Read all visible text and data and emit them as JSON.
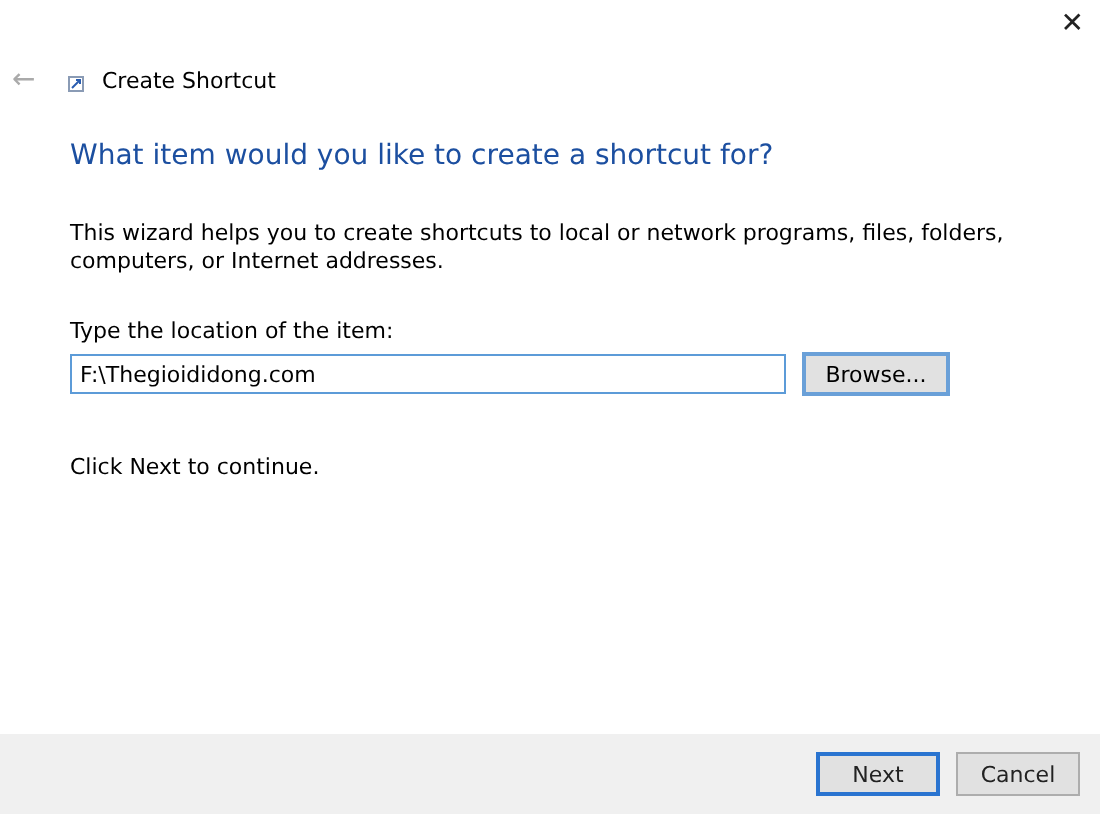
{
  "window": {
    "title": "Create Shortcut",
    "close": "✕",
    "back": "←"
  },
  "heading": "What item would you like to create a shortcut for?",
  "description": "This wizard helps you to create shortcuts to local or network programs, files, folders, computers, or Internet addresses.",
  "location": {
    "label": "Type the location of the item:",
    "value": "F:\\Thegioididong.com",
    "browse": "Browse..."
  },
  "hint": "Click Next to continue.",
  "buttons": [
    {
      "label": "Next",
      "default": true
    },
    {
      "label": "Cancel",
      "default": false
    }
  ]
}
